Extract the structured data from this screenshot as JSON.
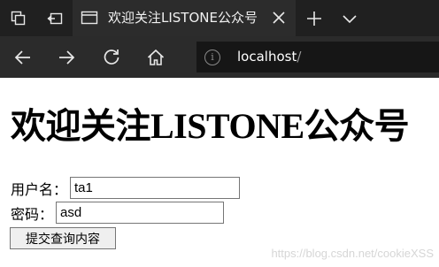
{
  "browser": {
    "tab": {
      "title": "欢迎关注LISTONE公众号"
    },
    "address": {
      "host": "localhost",
      "path": "/"
    },
    "icons": {
      "tab_actions": "tab-actions-icon",
      "set_aside": "set-aside-tabs-icon",
      "page": "page-icon",
      "close": "close-icon",
      "new_tab": "plus-icon",
      "tab_list": "chevron-down-icon",
      "back": "back-arrow-icon",
      "forward": "forward-arrow-icon",
      "refresh": "refresh-icon",
      "home": "home-icon",
      "site_info": "info-icon"
    }
  },
  "page": {
    "heading": "欢迎关注LISTONE公众号",
    "form": {
      "username_label": "用户名：",
      "username_value": "ta1",
      "password_label": "密码：",
      "password_value": "asd",
      "submit_label": "提交查询内容"
    },
    "watermark": "https://blog.csdn.net/cookieXSS"
  },
  "colors": {
    "tabbar_bg": "#202020",
    "active_tab_bg": "#2c2c2c",
    "navbar_bg": "#2b2b2b",
    "address_bg": "#161616",
    "page_bg": "#ffffff"
  }
}
